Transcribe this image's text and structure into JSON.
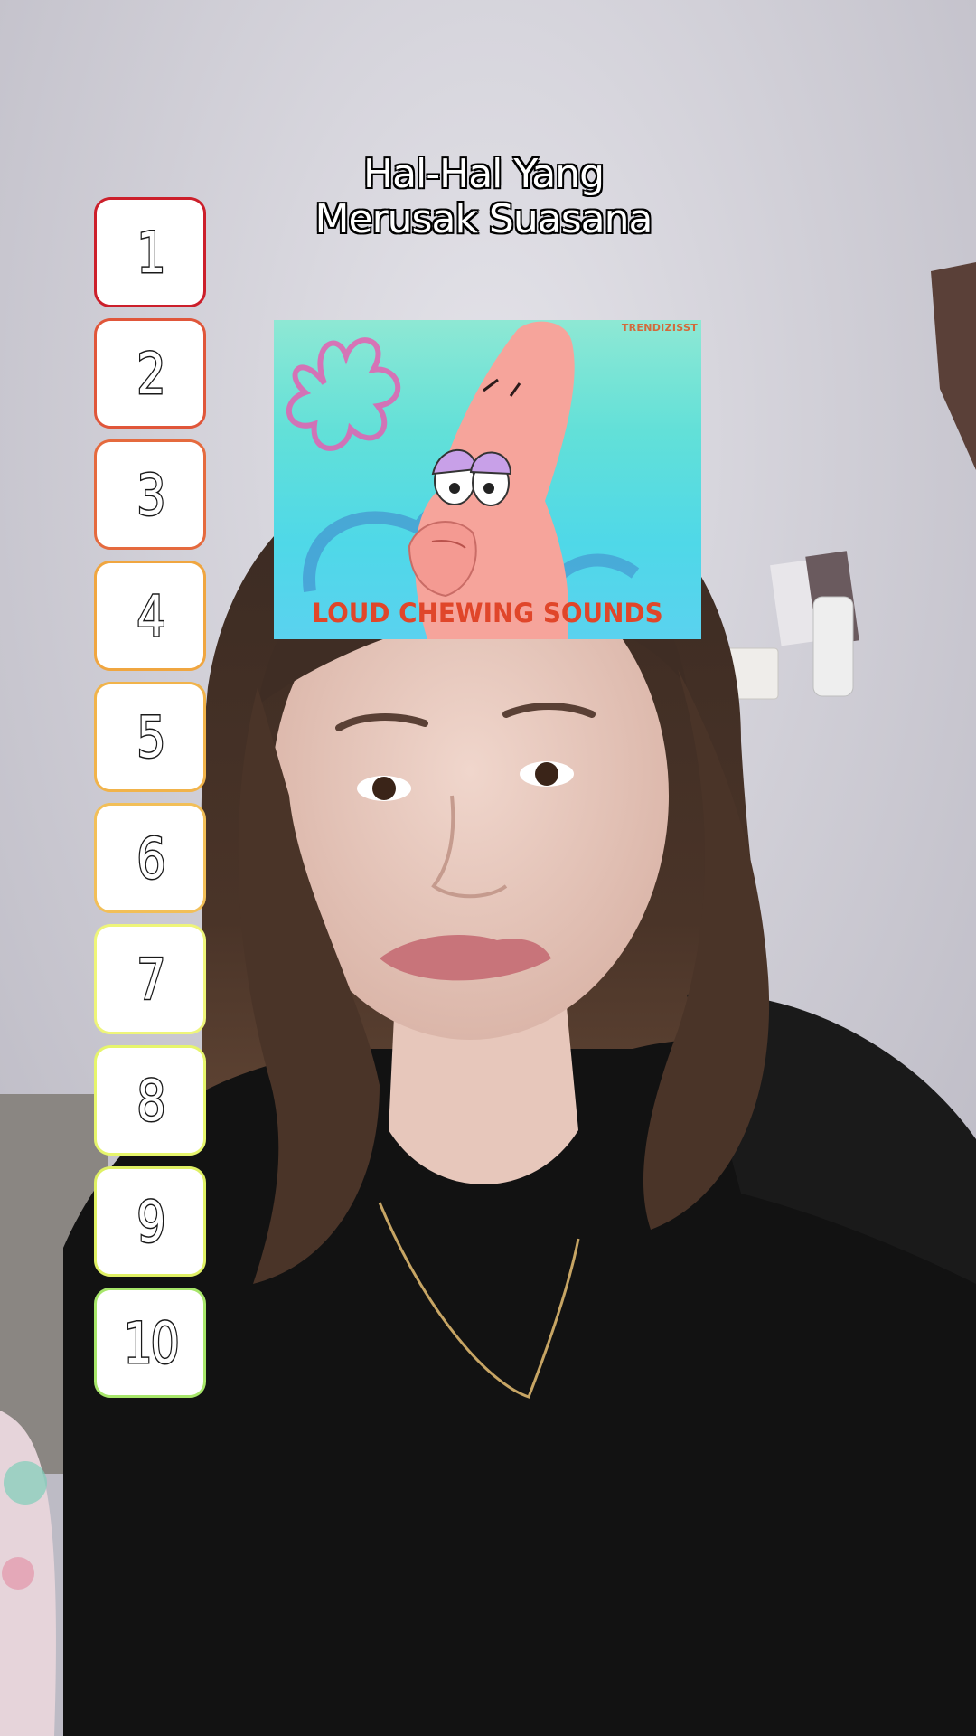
{
  "overlay": {
    "title_line_1": "Hal-Hal Yang",
    "title_line_2": "Merusak Suasana"
  },
  "ranking": {
    "items": [
      {
        "label": "1",
        "border_color": "#cc1f2b"
      },
      {
        "label": "2",
        "border_color": "#e0563a"
      },
      {
        "label": "3",
        "border_color": "#e56a3e"
      },
      {
        "label": "4",
        "border_color": "#f0a640"
      },
      {
        "label": "5",
        "border_color": "#f1b34a"
      },
      {
        "label": "6",
        "border_color": "#f2bf58"
      },
      {
        "label": "7",
        "border_color": "#eef57a"
      },
      {
        "label": "8",
        "border_color": "#e6f56c"
      },
      {
        "label": "9",
        "border_color": "#dff064"
      },
      {
        "label": "10",
        "border_color": "#a7e66a"
      }
    ]
  },
  "meme": {
    "caption": "LOUD CHEWING SOUNDS",
    "watermark": "TRENDIZISST",
    "character_icon": "patrick-star-icon"
  }
}
